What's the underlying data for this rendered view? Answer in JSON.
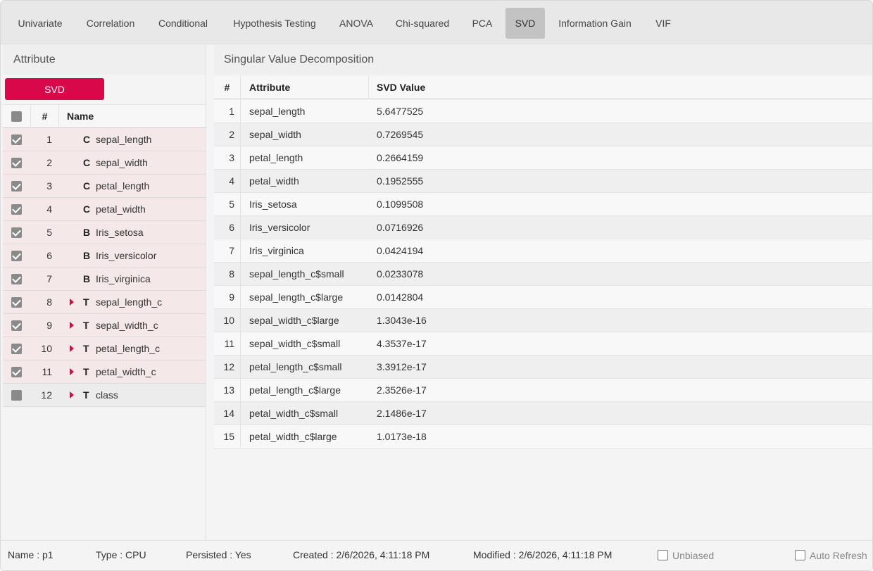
{
  "tabs": [
    {
      "label": "Univariate"
    },
    {
      "label": "Correlation"
    },
    {
      "label": "Conditional"
    },
    {
      "label": "Hypothesis Testing"
    },
    {
      "label": "ANOVA"
    },
    {
      "label": "Chi-squared"
    },
    {
      "label": "PCA"
    },
    {
      "label": "SVD"
    },
    {
      "label": "Information Gain"
    },
    {
      "label": "VIF"
    }
  ],
  "active_tab": "SVD",
  "left_panel": {
    "title": "Attribute",
    "button_label": "SVD",
    "columns": {
      "num": "#",
      "name": "Name"
    },
    "rows": [
      {
        "num": "1",
        "type": "C",
        "name": "sepal_length",
        "checked": true,
        "expandable": false
      },
      {
        "num": "2",
        "type": "C",
        "name": "sepal_width",
        "checked": true,
        "expandable": false
      },
      {
        "num": "3",
        "type": "C",
        "name": "petal_length",
        "checked": true,
        "expandable": false
      },
      {
        "num": "4",
        "type": "C",
        "name": "petal_width",
        "checked": true,
        "expandable": false
      },
      {
        "num": "5",
        "type": "B",
        "name": "Iris_setosa",
        "checked": true,
        "expandable": false
      },
      {
        "num": "6",
        "type": "B",
        "name": "Iris_versicolor",
        "checked": true,
        "expandable": false
      },
      {
        "num": "7",
        "type": "B",
        "name": "Iris_virginica",
        "checked": true,
        "expandable": false
      },
      {
        "num": "8",
        "type": "T",
        "name": "sepal_length_c",
        "checked": true,
        "expandable": true
      },
      {
        "num": "9",
        "type": "T",
        "name": "sepal_width_c",
        "checked": true,
        "expandable": true
      },
      {
        "num": "10",
        "type": "T",
        "name": "petal_length_c",
        "checked": true,
        "expandable": true
      },
      {
        "num": "11",
        "type": "T",
        "name": "petal_width_c",
        "checked": true,
        "expandable": true
      },
      {
        "num": "12",
        "type": "T",
        "name": "class",
        "checked": false,
        "expandable": true
      }
    ]
  },
  "right_panel": {
    "title": "Singular Value Decomposition",
    "columns": {
      "num": "#",
      "attribute": "Attribute",
      "value": "SVD Value"
    },
    "rows": [
      {
        "num": "1",
        "attribute": "sepal_length",
        "value": "5.6477525"
      },
      {
        "num": "2",
        "attribute": "sepal_width",
        "value": "0.7269545"
      },
      {
        "num": "3",
        "attribute": "petal_length",
        "value": "0.2664159"
      },
      {
        "num": "4",
        "attribute": "petal_width",
        "value": "0.1952555"
      },
      {
        "num": "5",
        "attribute": "Iris_setosa",
        "value": "0.1099508"
      },
      {
        "num": "6",
        "attribute": "Iris_versicolor",
        "value": "0.0716926"
      },
      {
        "num": "7",
        "attribute": "Iris_virginica",
        "value": "0.0424194"
      },
      {
        "num": "8",
        "attribute": "sepal_length_c$small",
        "value": "0.0233078"
      },
      {
        "num": "9",
        "attribute": "sepal_length_c$large",
        "value": "0.0142804"
      },
      {
        "num": "10",
        "attribute": "sepal_width_c$large",
        "value": "1.3043e-16"
      },
      {
        "num": "11",
        "attribute": "sepal_width_c$small",
        "value": "4.3537e-17"
      },
      {
        "num": "12",
        "attribute": "petal_length_c$small",
        "value": "3.3912e-17"
      },
      {
        "num": "13",
        "attribute": "petal_length_c$large",
        "value": "2.3526e-17"
      },
      {
        "num": "14",
        "attribute": "petal_width_c$small",
        "value": "2.1486e-17"
      },
      {
        "num": "15",
        "attribute": "petal_width_c$large",
        "value": "1.0173e-18"
      }
    ]
  },
  "status": {
    "name": "Name : p1",
    "type": "Type : CPU",
    "persisted": "Persisted : Yes",
    "created": "Created : 2/6/2026, 4:11:18 PM",
    "modified": "Modified : 2/6/2026, 4:11:18 PM",
    "unbiased_label": "Unbiased",
    "auto_refresh_label": "Auto Refresh"
  },
  "colors": {
    "accent": "#d9084a",
    "selected_row": "#f5e8e9",
    "active_tab": "#c3c3c3"
  }
}
